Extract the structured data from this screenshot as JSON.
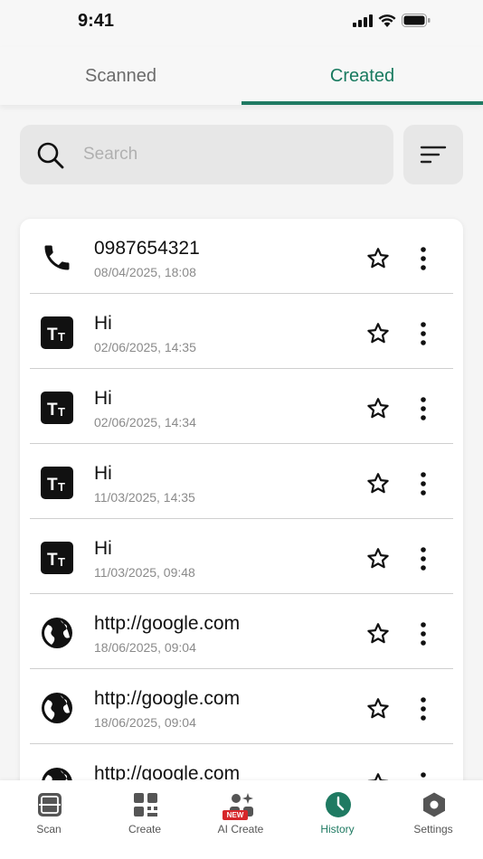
{
  "status_bar": {
    "time": "9:41"
  },
  "tabs": [
    {
      "label": "Scanned",
      "active": false
    },
    {
      "label": "Created",
      "active": true
    }
  ],
  "accent_color": "#1f7a62",
  "search": {
    "placeholder": "Search",
    "value": ""
  },
  "items": [
    {
      "type": "phone",
      "icon": "phone-icon",
      "title": "0987654321",
      "date": "08/04/2025, 18:08"
    },
    {
      "type": "text",
      "icon": "text-icon",
      "title": "Hi",
      "date": "02/06/2025, 14:35"
    },
    {
      "type": "text",
      "icon": "text-icon",
      "title": "Hi",
      "date": "02/06/2025, 14:34"
    },
    {
      "type": "text",
      "icon": "text-icon",
      "title": "Hi",
      "date": "11/03/2025, 14:35"
    },
    {
      "type": "text",
      "icon": "text-icon",
      "title": "Hi",
      "date": "11/03/2025, 09:48"
    },
    {
      "type": "url",
      "icon": "globe-icon",
      "title": "http://google.com",
      "date": "18/06/2025, 09:04"
    },
    {
      "type": "url",
      "icon": "globe-icon",
      "title": "http://google.com",
      "date": "18/06/2025, 09:04"
    },
    {
      "type": "url",
      "icon": "globe-icon",
      "title": "http://google.com",
      "date": ""
    }
  ],
  "bottom_nav": [
    {
      "label": "Scan",
      "icon": "scan-icon",
      "active": false
    },
    {
      "label": "Create",
      "icon": "create-grid-icon",
      "active": false
    },
    {
      "label": "AI Create",
      "icon": "ai-create-icon",
      "active": false,
      "badge": "NEW"
    },
    {
      "label": "History",
      "icon": "clock-icon",
      "active": true
    },
    {
      "label": "Settings",
      "icon": "hexagon-settings-icon",
      "active": false
    }
  ]
}
